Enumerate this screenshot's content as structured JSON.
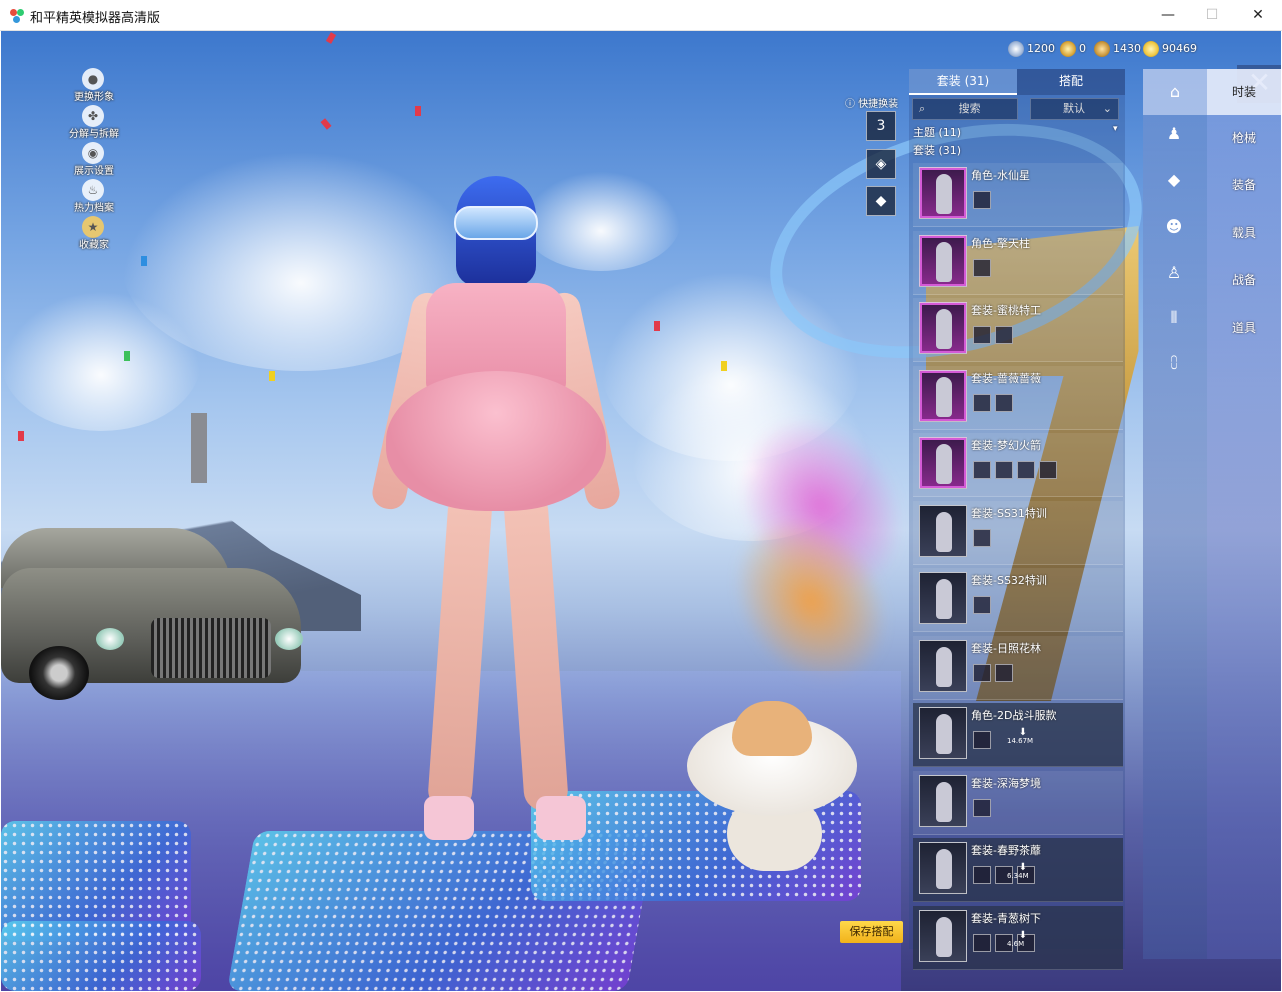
{
  "window": {
    "title": "和平精英模拟器高清版",
    "minimize": "—",
    "maximize": "☐",
    "close": "✕"
  },
  "side_menu": [
    {
      "label": "更换形象",
      "icon": "person-icon"
    },
    {
      "label": "分解与拆解",
      "icon": "gear-icon"
    },
    {
      "label": "展示设置",
      "icon": "eye-icon"
    },
    {
      "label": "热力档案",
      "icon": "flame-icon"
    },
    {
      "label": "收藏家",
      "icon": "badge-icon"
    }
  ],
  "currency": [
    {
      "value": "1200",
      "color": "#9fb6d9"
    },
    {
      "value": "0",
      "color": "#d9a63a"
    },
    {
      "value": "1430",
      "color": "#c9953a"
    },
    {
      "value": "90469",
      "color": "#f0c640"
    }
  ],
  "quick_swap": {
    "label": "快捷换装",
    "slot1": "3"
  },
  "panel": {
    "tab_outfits": "套装 (31)",
    "tab_match": "搭配",
    "search_placeholder": "搜索",
    "sort_label": "默认",
    "theme_line": "主题 (11)",
    "outfit_line": "套装 (31)"
  },
  "items": [
    {
      "name": "角色-水仙星",
      "style": "pink",
      "subs": 1
    },
    {
      "name": "角色-擎天柱",
      "style": "pink",
      "subs": 1
    },
    {
      "name": "套装-蜜桃特工",
      "style": "pink",
      "subs": 2
    },
    {
      "name": "套装-蔷薇蔷薇",
      "style": "pink",
      "subs": 2
    },
    {
      "name": "套装-梦幻火箭",
      "style": "pink",
      "subs": 4
    },
    {
      "name": "套装-SS31特训",
      "style": "grey",
      "subs": 1
    },
    {
      "name": "套装-SS32特训",
      "style": "grey",
      "subs": 1
    },
    {
      "name": "套装-日照花林",
      "style": "grey",
      "subs": 2
    },
    {
      "name": "角色-2D战斗服款",
      "style": "dark",
      "subs": 1,
      "download": "14.67M"
    },
    {
      "name": "套装-深海梦境",
      "style": "grey",
      "subs": 1
    },
    {
      "name": "套装-春野茶蘼",
      "style": "dark",
      "subs": 3,
      "download": "6.34M"
    },
    {
      "name": "套装-青葱树下",
      "style": "dark",
      "subs": 3,
      "download": "4.6M"
    }
  ],
  "categories": [
    "时装",
    "枪械",
    "装备",
    "载具",
    "战备",
    "道具"
  ],
  "icon_column": [
    "hanger-icon",
    "mannequin-icon",
    "cube-icon",
    "mask-icon",
    "outfit-icon",
    "pants-icon",
    "shoes-icon"
  ],
  "save_button": "保存搭配"
}
